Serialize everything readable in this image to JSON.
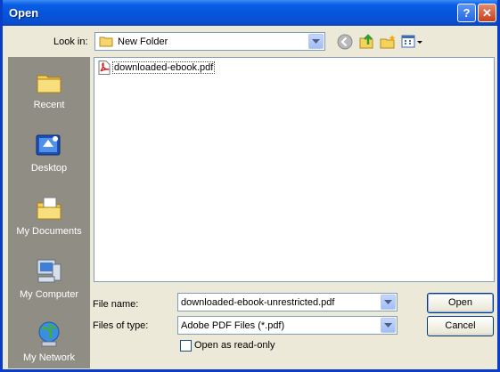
{
  "window": {
    "title": "Open"
  },
  "titlebar": {
    "help_glyph": "?",
    "close_glyph": "✕"
  },
  "toolbar": {
    "look_in_label": "Look in:",
    "look_in_value": "New Folder",
    "icons": [
      "back-icon",
      "up-one-level-icon",
      "create-new-folder-icon",
      "view-menu-icon"
    ]
  },
  "places": [
    {
      "label": "Recent",
      "icon": "recent-icon"
    },
    {
      "label": "Desktop",
      "icon": "desktop-icon"
    },
    {
      "label": "My Documents",
      "icon": "my-documents-icon"
    },
    {
      "label": "My Computer",
      "icon": "my-computer-icon"
    },
    {
      "label": "My Network",
      "icon": "my-network-icon"
    }
  ],
  "files": [
    {
      "name": "downloaded-ebook.pdf",
      "icon": "pdf-file-icon"
    }
  ],
  "form": {
    "file_name_label": "File name:",
    "file_name_value": "downloaded-ebook-unrestricted.pdf",
    "files_of_type_label": "Files of type:",
    "files_of_type_value": "Adobe PDF Files (*.pdf)",
    "read_only_label": "Open as read-only",
    "read_only_checked": false
  },
  "buttons": {
    "open": "Open",
    "cancel": "Cancel"
  },
  "colors": {
    "titlebar": "#0654dc",
    "dialog_bg": "#ece9d8",
    "places_bar": "#8f8d84",
    "field_border": "#7f9db9"
  }
}
